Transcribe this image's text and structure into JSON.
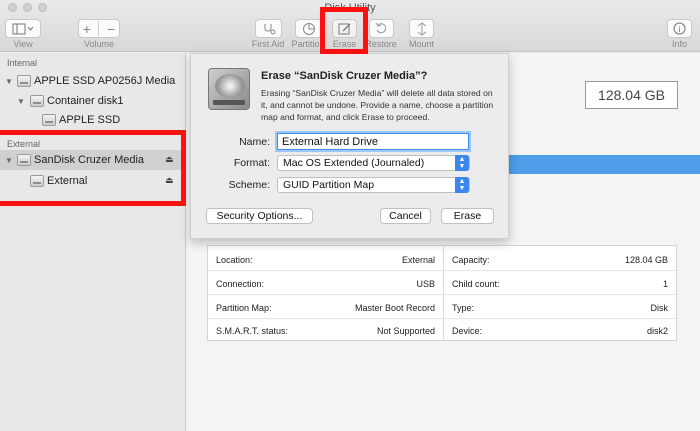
{
  "window": {
    "title": "Disk Utility"
  },
  "toolbar": {
    "view": "View",
    "volume": "Volume",
    "first_aid": "First Aid",
    "partition": "Partition",
    "erase": "Erase",
    "restore": "Restore",
    "mount": "Mount",
    "info": "Info"
  },
  "sidebar": {
    "internal_header": "Internal",
    "external_header": "External",
    "items": {
      "apple_ssd_media": "APPLE SSD AP0256J Media",
      "container": "Container disk1",
      "apple_ssd": "APPLE SSD",
      "sandisk": "SanDisk Cruzer Media",
      "external_volume": "External"
    }
  },
  "main": {
    "capacity_display": "128.04 GB",
    "info": {
      "left": [
        {
          "label": "Location:",
          "value": "External"
        },
        {
          "label": "Connection:",
          "value": "USB"
        },
        {
          "label": "Partition Map:",
          "value": "Master Boot Record"
        },
        {
          "label": "S.M.A.R.T. status:",
          "value": "Not Supported"
        }
      ],
      "right": [
        {
          "label": "Capacity:",
          "value": "128.04 GB"
        },
        {
          "label": "Child count:",
          "value": "1"
        },
        {
          "label": "Type:",
          "value": "Disk"
        },
        {
          "label": "Device:",
          "value": "disk2"
        }
      ]
    }
  },
  "dialog": {
    "title": "Erase “SanDisk Cruzer Media”?",
    "description": "Erasing “SanDisk Cruzer Media” will delete all data stored on it, and cannot be undone. Provide a name, choose a partition map and format, and click Erase to proceed.",
    "name_label": "Name:",
    "name_value": "External Hard Drive",
    "format_label": "Format:",
    "format_value": "Mac OS Extended (Journaled)",
    "scheme_label": "Scheme:",
    "scheme_value": "GUID Partition Map",
    "security_options": "Security Options...",
    "cancel": "Cancel",
    "erase": "Erase"
  },
  "colors": {
    "highlight": "#ff1010",
    "accent": "#3b86f0",
    "bar": "#4d9de8"
  }
}
